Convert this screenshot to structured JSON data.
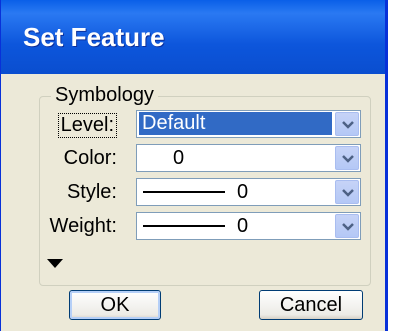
{
  "window": {
    "title": "Set Feature"
  },
  "symbology": {
    "group_label": "Symbology",
    "level": {
      "label": "Level:",
      "value": "Default"
    },
    "color": {
      "label": "Color:",
      "value": "0"
    },
    "style": {
      "label": "Style:",
      "value": "0"
    },
    "weight": {
      "label": "Weight:",
      "value": "0"
    }
  },
  "expander_icon": "triangle-down-icon",
  "buttons": {
    "ok_label": "OK",
    "cancel_label": "Cancel"
  },
  "colors": {
    "titlebar": "#0a4ecf",
    "dialog_bg": "#ece9d8",
    "selection": "#316ac5",
    "dropdown": "#c6d3f7"
  }
}
